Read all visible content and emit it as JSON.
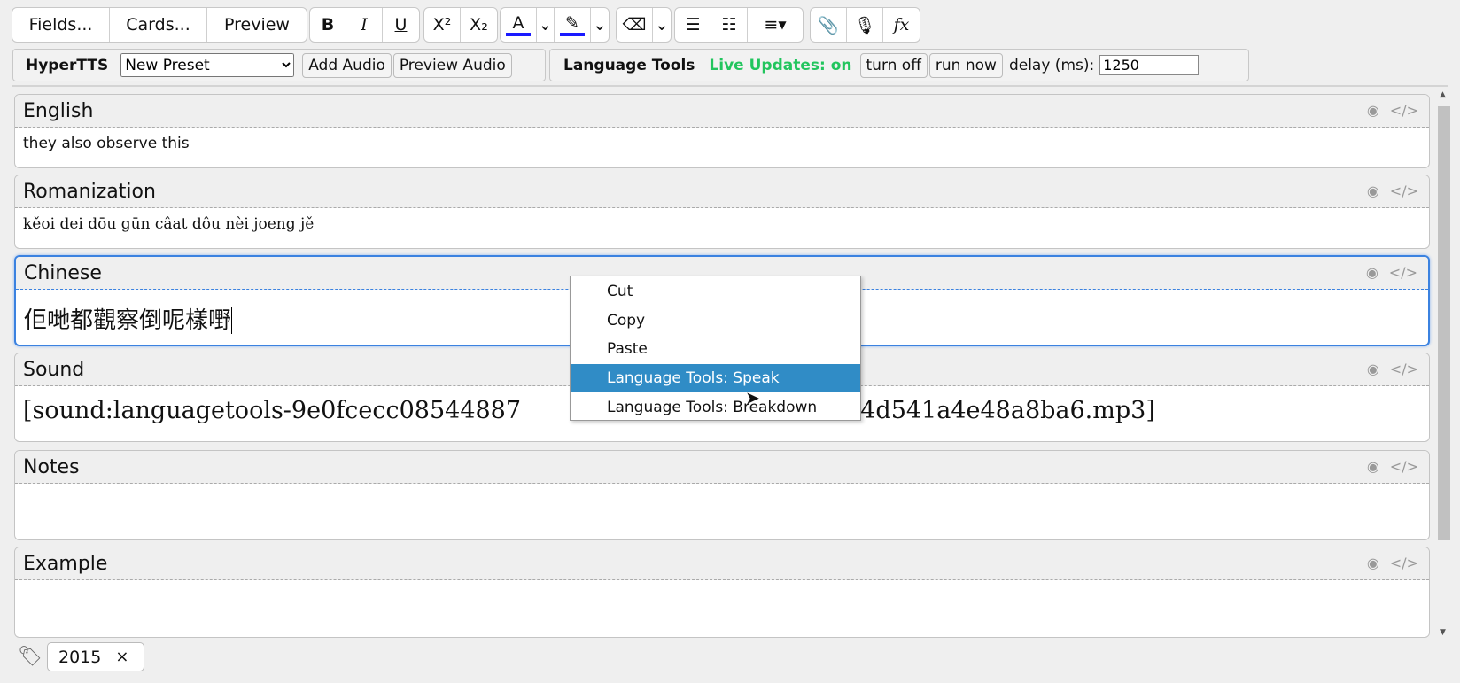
{
  "toolbar": {
    "fields": "Fields...",
    "cards": "Cards...",
    "preview": "Preview",
    "bold": "B",
    "italic": "I",
    "underline": "U",
    "superscript": "X²",
    "subscript": "X₂",
    "function": "fx",
    "text_color": "#1a1aff",
    "highlight_color": "#1a1aff"
  },
  "hypertts": {
    "label": "HyperTTS",
    "preset": "New Preset",
    "add_audio": "Add Audio",
    "preview_audio": "Preview Audio"
  },
  "language_tools": {
    "label": "Language Tools",
    "live_updates": "Live Updates: on",
    "live_color": "#22c55e",
    "turn_off": "turn off",
    "run_now": "run now",
    "delay_label": "delay (ms):",
    "delay_value": "1250"
  },
  "fields": [
    {
      "label": "English",
      "value": "they also observe this"
    },
    {
      "label": "Romanization",
      "value": "kěoi dei dōu gūn câat dôu nèi joeng jě"
    },
    {
      "label": "Chinese",
      "value": "佢哋都觀察倒呢樣嘢"
    },
    {
      "label": "Sound",
      "value_start": "[sound:languagetools-9e0fcecc08544887",
      "value_end": "097a6ac84d541a4e48a8ba6.mp3]"
    },
    {
      "label": "Notes",
      "value": ""
    },
    {
      "label": "Example",
      "value": ""
    }
  ],
  "context_menu": [
    "Cut",
    "Copy",
    "Paste",
    "Language Tools: Speak",
    "Language Tools: Breakdown"
  ],
  "tags": [
    "2015"
  ],
  "tag_remove": "×"
}
